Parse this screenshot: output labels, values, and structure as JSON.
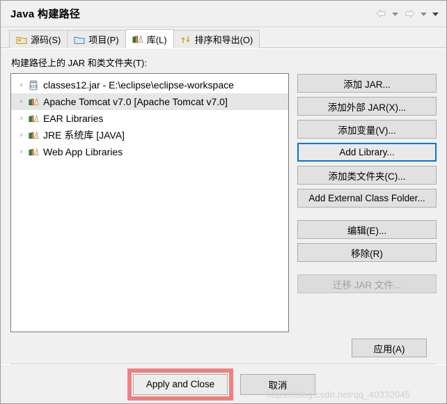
{
  "window": {
    "title": "Java 构建路径"
  },
  "nav": {
    "back_icon": "arrow-left-icon",
    "back_menu_icon": "chevron-down-icon",
    "forward_icon": "arrow-right-icon",
    "forward_menu_icon": "chevron-down-icon",
    "more_menu_icon": "chevron-down-icon"
  },
  "tabs": [
    {
      "label": "源码(S)",
      "icon": "source-folder-icon",
      "selected": false
    },
    {
      "label": "项目(P)",
      "icon": "project-folder-icon",
      "selected": false
    },
    {
      "label": "库(L)",
      "icon": "library-books-icon",
      "selected": true
    },
    {
      "label": "排序和导出(O)",
      "icon": "order-export-icon",
      "selected": false
    }
  ],
  "main": {
    "list_label": "构建路径上的 JAR 和类文件夹(T):",
    "tree_items": [
      {
        "label": "classes12.jar - E:\\eclipse\\eclipse-workspace",
        "icon": "jar-icon",
        "selected": false,
        "expander": "›"
      },
      {
        "label": "Apache Tomcat v7.0 [Apache Tomcat v7.0]",
        "icon": "library-books-icon",
        "selected": true,
        "expander": "›"
      },
      {
        "label": "EAR Libraries",
        "icon": "library-books-icon",
        "selected": false,
        "expander": "›"
      },
      {
        "label": "JRE 系统库 [JAVA]",
        "icon": "library-books-icon",
        "selected": false,
        "expander": "›"
      },
      {
        "label": "Web App Libraries",
        "icon": "library-books-icon",
        "selected": false,
        "expander": "›"
      }
    ],
    "buttons": [
      {
        "label": "添加 JAR...",
        "state": "normal"
      },
      {
        "label": "添加外部 JAR(X)...",
        "state": "normal"
      },
      {
        "label": "添加变量(V)...",
        "state": "normal"
      },
      {
        "label": "Add Library...",
        "state": "focused"
      },
      {
        "label": "添加类文件夹(C)...",
        "state": "normal"
      },
      {
        "label": "Add External Class Folder...",
        "state": "normal"
      },
      {
        "label": "编辑(E)...",
        "state": "normal"
      },
      {
        "label": "移除(R)",
        "state": "normal"
      },
      {
        "label": "迁移 JAR 文件...",
        "state": "disabled"
      }
    ]
  },
  "footer": {
    "apply_label": "应用(A)",
    "apply_and_close_label": "Apply and Close",
    "cancel_label": "取消",
    "watermark": "https://blog.csdn.net/qq_40332045"
  },
  "colors": {
    "focus_blue": "#0078d7",
    "highlight_red": "#f08080",
    "selection_gray": "#e6e6e6",
    "dialog_bg": "#f0f0f0"
  }
}
